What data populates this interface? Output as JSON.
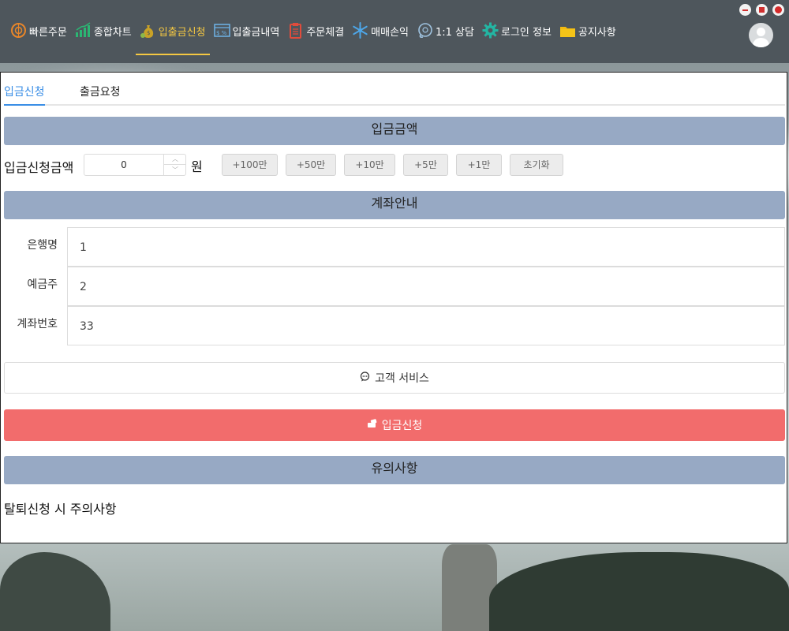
{
  "window": {
    "controls": [
      "minimize",
      "maximize",
      "close"
    ]
  },
  "nav": {
    "items": [
      {
        "label": "빠른주문",
        "icon": "quick-order-icon"
      },
      {
        "label": "종합차트",
        "icon": "chart-icon"
      },
      {
        "label": "입출금신청",
        "icon": "money-bag-icon",
        "active": true
      },
      {
        "label": "입출금내역",
        "icon": "statement-icon"
      },
      {
        "label": "주문체결",
        "icon": "clipboard-icon"
      },
      {
        "label": "매매손익",
        "icon": "snowflake-icon"
      },
      {
        "label": "1:1 상담",
        "icon": "consult-icon"
      },
      {
        "label": "로그인 정보",
        "icon": "gear-icon"
      },
      {
        "label": "공지사항",
        "icon": "folder-icon"
      }
    ],
    "accent": "#f5c842"
  },
  "tabs": {
    "deposit": "입금신청",
    "withdraw": "출금요청"
  },
  "deposit_section": {
    "title": "입금금액",
    "amount_label": "입금신청금액",
    "amount_value": "0",
    "unit": "원",
    "quick_buttons": [
      "+100만",
      "+50만",
      "+10만",
      "+5만",
      "+1만",
      "초기화"
    ]
  },
  "account_section": {
    "title": "계좌안내",
    "bank_label": "은행명",
    "bank_value": "1",
    "holder_label": "예금주",
    "holder_value": "2",
    "account_label": "계좌번호",
    "account_value": "33"
  },
  "service_button": "고객 서비스",
  "submit_button": "입금신청",
  "notice_section": {
    "title": "유의사항",
    "text": "탈퇴신청 시 주의사항"
  },
  "colors": {
    "header_bg": "#4e565c",
    "section_bg": "#97a9c4",
    "tab_active": "#3a8ee6",
    "submit_bg": "#f26c6c"
  }
}
